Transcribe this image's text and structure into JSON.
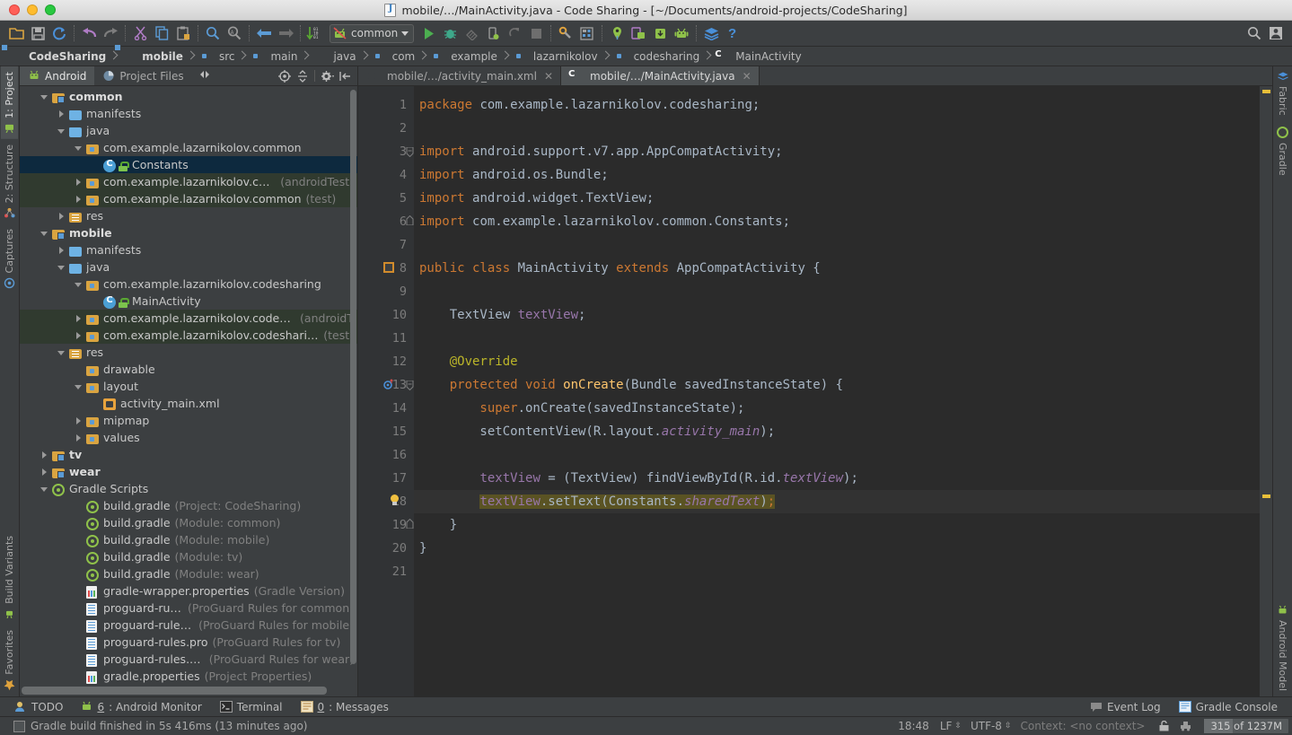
{
  "window": {
    "title": "mobile/…/MainActivity.java - Code Sharing - [~/Documents/android-projects/CodeSharing]",
    "file_icon": "java-file-icon"
  },
  "toolbar": {
    "run_config": "common",
    "icons": [
      "open-folder-icon",
      "save-all-icon",
      "sync-icon",
      "undo-icon",
      "redo-icon",
      "cut-icon",
      "copy-icon",
      "paste-icon",
      "find-icon",
      "find-replace-icon",
      "back-icon",
      "forward-icon",
      "sort-icon"
    ],
    "right_icons": [
      "search-everywhere-icon",
      "user-account-icon"
    ],
    "run_icons": [
      "run-icon",
      "debug-icon",
      "coverage-icon",
      "instant-run-icon",
      "rerun-icon",
      "stop-icon",
      "sdk-manager-icon",
      "avd-manager-icon",
      "layout-inspector-icon",
      "device-monitor-icon",
      "sdk-download-icon",
      "android-icon",
      "fabric-icon",
      "help-icon"
    ]
  },
  "breadcrumb": [
    {
      "label": "CodeSharing",
      "icon": "module-folder-icon",
      "bold": true
    },
    {
      "label": "mobile",
      "icon": "module-folder-icon",
      "bold": true
    },
    {
      "label": "src",
      "icon": "folder-icon",
      "bold": false
    },
    {
      "label": "main",
      "icon": "folder-icon",
      "bold": false
    },
    {
      "label": "java",
      "icon": "java-folder-icon",
      "bold": false
    },
    {
      "label": "com",
      "icon": "package-icon",
      "bold": false
    },
    {
      "label": "example",
      "icon": "package-icon",
      "bold": false
    },
    {
      "label": "lazarnikolov",
      "icon": "package-icon",
      "bold": false
    },
    {
      "label": "codesharing",
      "icon": "package-icon",
      "bold": false
    },
    {
      "label": "MainActivity",
      "icon": "class-icon",
      "bold": false
    }
  ],
  "left_rail": [
    {
      "label": "1: Project",
      "icon": "android-project-icon",
      "selected": true
    },
    {
      "label": "2: Structure",
      "icon": "structure-icon",
      "selected": false
    },
    {
      "label": "Captures",
      "icon": "captures-icon",
      "selected": false
    },
    {
      "label": "Build Variants",
      "icon": "build-variants-icon",
      "selected": false
    },
    {
      "label": "Favorites",
      "icon": "star-icon",
      "selected": false
    }
  ],
  "right_rail": [
    {
      "label": "Fabric",
      "icon": "fabric-icon"
    },
    {
      "label": "Gradle",
      "icon": "gradle-icon"
    },
    {
      "label": "Android Model",
      "icon": "android-icon"
    }
  ],
  "project_panel": {
    "tabs": [
      {
        "label": "Android",
        "icon": "android-icon",
        "selected": true
      },
      {
        "label": "Project Files",
        "icon": "project-files-icon",
        "selected": false
      }
    ],
    "tools": [
      "expand-collapse-icon",
      "scroll-from-source-icon",
      "collapse-all-icon",
      "settings-gear-icon",
      "hide-panel-icon"
    ],
    "tree": [
      {
        "indent": 0,
        "twisty": "open",
        "icon": "module-folder-icon",
        "label": "common",
        "sub": "",
        "bold": true,
        "state": ""
      },
      {
        "indent": 1,
        "twisty": "closed",
        "icon": "folder-icon",
        "label": "manifests",
        "sub": "",
        "bold": false,
        "state": ""
      },
      {
        "indent": 1,
        "twisty": "open",
        "icon": "java-folder-icon",
        "label": "java",
        "sub": "",
        "bold": false,
        "state": ""
      },
      {
        "indent": 2,
        "twisty": "open",
        "icon": "package-icon",
        "label": "com.example.lazarnikolov.common",
        "sub": "",
        "bold": false,
        "state": ""
      },
      {
        "indent": 3,
        "twisty": "none",
        "icon": "class-lock-icon",
        "label": "Constants",
        "sub": "",
        "bold": false,
        "state": "selected"
      },
      {
        "indent": 2,
        "twisty": "closed",
        "icon": "package-icon",
        "label": "com.example.lazarnikolov.common",
        "sub": "(androidTest)",
        "bold": false,
        "state": "testsrc"
      },
      {
        "indent": 2,
        "twisty": "closed",
        "icon": "package-icon",
        "label": "com.example.lazarnikolov.common",
        "sub": "(test)",
        "bold": false,
        "state": "testsrc"
      },
      {
        "indent": 1,
        "twisty": "closed",
        "icon": "res-folder-icon",
        "label": "res",
        "sub": "",
        "bold": false,
        "state": ""
      },
      {
        "indent": 0,
        "twisty": "open",
        "icon": "module-folder-icon",
        "label": "mobile",
        "sub": "",
        "bold": true,
        "state": ""
      },
      {
        "indent": 1,
        "twisty": "closed",
        "icon": "folder-icon",
        "label": "manifests",
        "sub": "",
        "bold": false,
        "state": ""
      },
      {
        "indent": 1,
        "twisty": "open",
        "icon": "java-folder-icon",
        "label": "java",
        "sub": "",
        "bold": false,
        "state": ""
      },
      {
        "indent": 2,
        "twisty": "open",
        "icon": "package-icon",
        "label": "com.example.lazarnikolov.codesharing",
        "sub": "",
        "bold": false,
        "state": ""
      },
      {
        "indent": 3,
        "twisty": "none",
        "icon": "class-lock-icon",
        "label": "MainActivity",
        "sub": "",
        "bold": false,
        "state": ""
      },
      {
        "indent": 2,
        "twisty": "closed",
        "icon": "package-icon",
        "label": "com.example.lazarnikolov.codesharing",
        "sub": "(androidT",
        "bold": false,
        "state": "testsrc"
      },
      {
        "indent": 2,
        "twisty": "closed",
        "icon": "package-icon",
        "label": "com.example.lazarnikolov.codesharing",
        "sub": "(test)",
        "bold": false,
        "state": "testsrc"
      },
      {
        "indent": 1,
        "twisty": "open",
        "icon": "res-folder-icon",
        "label": "res",
        "sub": "",
        "bold": false,
        "state": ""
      },
      {
        "indent": 2,
        "twisty": "none",
        "icon": "package-icon",
        "label": "drawable",
        "sub": "",
        "bold": false,
        "state": ""
      },
      {
        "indent": 2,
        "twisty": "open",
        "icon": "package-icon",
        "label": "layout",
        "sub": "",
        "bold": false,
        "state": ""
      },
      {
        "indent": 3,
        "twisty": "none",
        "icon": "xml-layout-icon",
        "label": "activity_main.xml",
        "sub": "",
        "bold": false,
        "state": ""
      },
      {
        "indent": 2,
        "twisty": "closed",
        "icon": "package-icon",
        "label": "mipmap",
        "sub": "",
        "bold": false,
        "state": ""
      },
      {
        "indent": 2,
        "twisty": "closed",
        "icon": "package-icon",
        "label": "values",
        "sub": "",
        "bold": false,
        "state": ""
      },
      {
        "indent": 0,
        "twisty": "closed",
        "icon": "module-folder-icon",
        "label": "tv",
        "sub": "",
        "bold": true,
        "state": ""
      },
      {
        "indent": 0,
        "twisty": "closed",
        "icon": "module-folder-icon",
        "label": "wear",
        "sub": "",
        "bold": true,
        "state": ""
      },
      {
        "indent": 0,
        "twisty": "open",
        "icon": "gradle-icon",
        "label": "Gradle Scripts",
        "sub": "",
        "bold": false,
        "state": ""
      },
      {
        "indent": 2,
        "twisty": "none",
        "icon": "gradle-icon",
        "label": "build.gradle",
        "sub": "(Project: CodeSharing)",
        "bold": false,
        "state": ""
      },
      {
        "indent": 2,
        "twisty": "none",
        "icon": "gradle-icon",
        "label": "build.gradle",
        "sub": "(Module: common)",
        "bold": false,
        "state": ""
      },
      {
        "indent": 2,
        "twisty": "none",
        "icon": "gradle-icon",
        "label": "build.gradle",
        "sub": "(Module: mobile)",
        "bold": false,
        "state": ""
      },
      {
        "indent": 2,
        "twisty": "none",
        "icon": "gradle-icon",
        "label": "build.gradle",
        "sub": "(Module: tv)",
        "bold": false,
        "state": ""
      },
      {
        "indent": 2,
        "twisty": "none",
        "icon": "gradle-icon",
        "label": "build.gradle",
        "sub": "(Module: wear)",
        "bold": false,
        "state": ""
      },
      {
        "indent": 2,
        "twisty": "none",
        "icon": "properties-icon",
        "label": "gradle-wrapper.properties",
        "sub": "(Gradle Version)",
        "bold": false,
        "state": ""
      },
      {
        "indent": 2,
        "twisty": "none",
        "icon": "text-file-icon",
        "label": "proguard-rules.pro",
        "sub": "(ProGuard Rules for common)",
        "bold": false,
        "state": ""
      },
      {
        "indent": 2,
        "twisty": "none",
        "icon": "text-file-icon",
        "label": "proguard-rules.pro",
        "sub": "(ProGuard Rules for mobile)",
        "bold": false,
        "state": ""
      },
      {
        "indent": 2,
        "twisty": "none",
        "icon": "text-file-icon",
        "label": "proguard-rules.pro",
        "sub": "(ProGuard Rules for tv)",
        "bold": false,
        "state": ""
      },
      {
        "indent": 2,
        "twisty": "none",
        "icon": "text-file-icon",
        "label": "proguard-rules.pro",
        "sub": "(ProGuard Rules for wear)",
        "bold": false,
        "state": ""
      },
      {
        "indent": 2,
        "twisty": "none",
        "icon": "properties-icon",
        "label": "gradle.properties",
        "sub": "(Project Properties)",
        "bold": false,
        "state": ""
      }
    ]
  },
  "editor": {
    "tabs": [
      {
        "label": "mobile/…/activity_main.xml",
        "icon": "xml-layout-icon",
        "selected": false,
        "close": "✕"
      },
      {
        "label": "mobile/…/MainActivity.java",
        "icon": "class-icon",
        "selected": true,
        "close": "✕"
      }
    ],
    "line_numbers": [
      "1",
      "2",
      "3",
      "4",
      "5",
      "6",
      "7",
      "8",
      "9",
      "10",
      "11",
      "12",
      "13",
      "14",
      "15",
      "16",
      "17",
      "18",
      "19",
      "20",
      "21"
    ],
    "lines": [
      {
        "n": 1,
        "tokens": [
          {
            "t": "package ",
            "c": "kw"
          },
          {
            "t": "com.example.lazarnikolov.codesharing;",
            "c": "pl"
          }
        ]
      },
      {
        "n": 2,
        "tokens": []
      },
      {
        "n": 3,
        "tokens": [
          {
            "t": "import ",
            "c": "kw"
          },
          {
            "t": "android.support.v7.app.AppCompatActivity;",
            "c": "pl"
          }
        ]
      },
      {
        "n": 4,
        "tokens": [
          {
            "t": "import ",
            "c": "kw"
          },
          {
            "t": "android.os.Bundle;",
            "c": "pl"
          }
        ]
      },
      {
        "n": 5,
        "tokens": [
          {
            "t": "import ",
            "c": "kw"
          },
          {
            "t": "android.widget.TextView;",
            "c": "pl"
          }
        ]
      },
      {
        "n": 6,
        "tokens": [
          {
            "t": "import ",
            "c": "kw"
          },
          {
            "t": "com.example.lazarnikolov.common.Constants;",
            "c": "pl"
          }
        ]
      },
      {
        "n": 7,
        "tokens": []
      },
      {
        "n": 8,
        "tokens": [
          {
            "t": "public class ",
            "c": "kw"
          },
          {
            "t": "MainActivity ",
            "c": "pl"
          },
          {
            "t": "extends ",
            "c": "kw"
          },
          {
            "t": "AppCompatActivity {",
            "c": "pl"
          }
        ]
      },
      {
        "n": 9,
        "tokens": []
      },
      {
        "n": 10,
        "tokens": [
          {
            "t": "    TextView ",
            "c": "pl"
          },
          {
            "t": "textView",
            "c": "fld"
          },
          {
            "t": ";",
            "c": "pl"
          }
        ]
      },
      {
        "n": 11,
        "tokens": []
      },
      {
        "n": 12,
        "tokens": [
          {
            "t": "    @Override",
            "c": "ann"
          }
        ]
      },
      {
        "n": 13,
        "tokens": [
          {
            "t": "    protected void ",
            "c": "kw"
          },
          {
            "t": "onCreate",
            "c": "mth"
          },
          {
            "t": "(Bundle savedInstanceState) {",
            "c": "pl"
          }
        ]
      },
      {
        "n": 14,
        "tokens": [
          {
            "t": "        super",
            "c": "kw"
          },
          {
            "t": ".onCreate(savedInstanceState);",
            "c": "pl"
          }
        ]
      },
      {
        "n": 15,
        "tokens": [
          {
            "t": "        setContentView(R.layout.",
            "c": "pl"
          },
          {
            "t": "activity_main",
            "c": "fldi"
          },
          {
            "t": ");",
            "c": "pl"
          }
        ]
      },
      {
        "n": 16,
        "tokens": []
      },
      {
        "n": 17,
        "tokens": [
          {
            "t": "        ",
            "c": "pl"
          },
          {
            "t": "textView",
            "c": "fld"
          },
          {
            "t": " = (TextView) findViewById(R.id.",
            "c": "pl"
          },
          {
            "t": "textView",
            "c": "fldi"
          },
          {
            "t": ");",
            "c": "pl"
          }
        ]
      },
      {
        "n": 18,
        "tokens": [
          {
            "t": "        ",
            "c": "pl"
          },
          {
            "t": "textView",
            "c": "fld"
          },
          {
            "t": ".setText(Constants.",
            "c": "pl"
          },
          {
            "t": "sharedText",
            "c": "fldi"
          },
          {
            "t": ")",
            "c": "pl"
          },
          {
            "t": ";",
            "c": "kw"
          }
        ]
      },
      {
        "n": 19,
        "tokens": [
          {
            "t": "    }",
            "c": "pl"
          }
        ]
      },
      {
        "n": 20,
        "tokens": [
          {
            "t": "}",
            "c": "pl"
          }
        ]
      },
      {
        "n": 21,
        "tokens": []
      }
    ],
    "gutter_marks": [
      {
        "line": 8,
        "icon": "class-marker-icon"
      },
      {
        "line": 13,
        "icon": "override-method-icon"
      },
      {
        "line": 18,
        "icon": "intention-bulb-icon"
      }
    ],
    "fold_marks": [
      {
        "line": 3,
        "icon": "fold-start-icon"
      },
      {
        "line": 6,
        "icon": "fold-end-icon"
      },
      {
        "line": 13,
        "icon": "fold-start-icon"
      },
      {
        "line": 19,
        "icon": "fold-end-icon"
      }
    ],
    "highlighted_line": 18
  },
  "bottom_tools": [
    {
      "label": "TODO",
      "icon": "todo-icon",
      "mnemonic": ""
    },
    {
      "label": ": Android Monitor",
      "icon": "android-icon",
      "mnemonic": "6"
    },
    {
      "label": "Terminal",
      "icon": "terminal-icon",
      "mnemonic": ""
    },
    {
      "label": ": Messages",
      "icon": "messages-icon",
      "mnemonic": "0"
    }
  ],
  "bottom_tools_right": [
    {
      "label": "Event Log",
      "icon": "event-log-icon"
    },
    {
      "label": "Gradle Console",
      "icon": "gradle-console-icon"
    }
  ],
  "status": {
    "message": "Gradle build finished in 5s 416ms (13 minutes ago)",
    "message_icon": "build-status-icon",
    "time": "18:48",
    "line_separator": "LF",
    "encoding": "UTF-8",
    "context": "Context: <no context>",
    "lock_icon": "read-only-lock-icon",
    "vcs_icon": "vcs-icon",
    "memory": "315 of 1237M"
  },
  "colors": {
    "chrome": "#3c3f41",
    "editor_bg": "#2b2b2b",
    "gutter_bg": "#313335",
    "selection": "#0d293e",
    "test_source": "#303a2f",
    "keyword": "#cc7832",
    "plain": "#a9b7c6",
    "field": "#9876aa",
    "annotation": "#bbb529",
    "method": "#ffc66d",
    "line_highlight": "#5a5323",
    "marker_yellow": "#e8bf3a"
  }
}
